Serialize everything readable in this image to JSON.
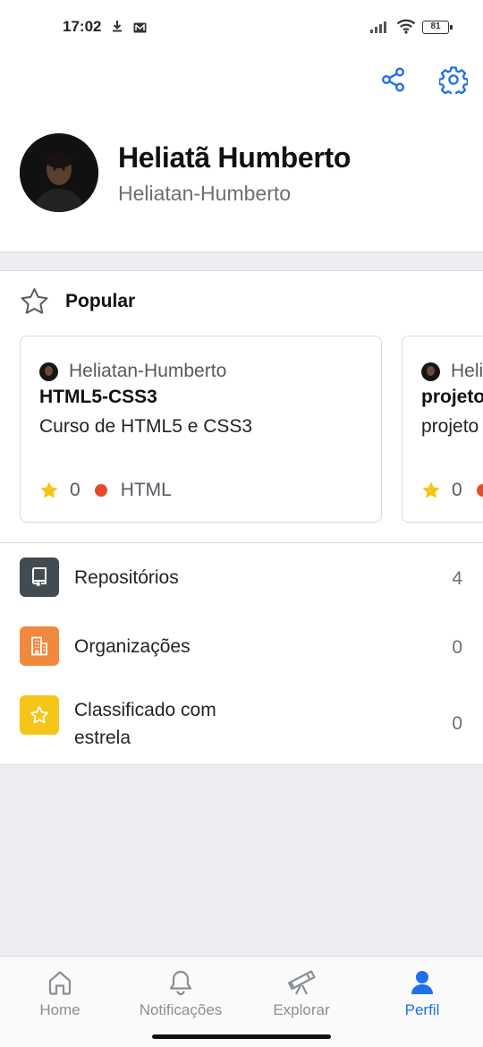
{
  "status_bar": {
    "time": "17:02",
    "battery": "81"
  },
  "header": {
    "share_icon": "share-icon",
    "settings_icon": "gear-icon"
  },
  "profile": {
    "name": "Heliatã Humberto",
    "login": "Heliatan-Humberto"
  },
  "popular": {
    "title": "Popular",
    "cards": [
      {
        "owner": "Heliatan-Humberto",
        "repo": "HTML5-CSS3",
        "description": "Curso de HTML5 e CSS3",
        "stars": "0",
        "language": "HTML",
        "language_color": "#e34c26"
      },
      {
        "owner": "Heliatan-Humberto",
        "repo": "projeto",
        "description": "projeto",
        "stars": "0",
        "language": "",
        "language_color": "#e34c26"
      }
    ]
  },
  "menu": {
    "items": [
      {
        "label": "Repositórios",
        "count": "4",
        "color": "#424a53",
        "icon": "repo-icon"
      },
      {
        "label": "Organizações",
        "count": "0",
        "color": "#f0883e",
        "icon": "organization-icon"
      },
      {
        "label": "Classificado com estrela",
        "count": "0",
        "color": "#f5c518",
        "icon": "star-icon"
      }
    ]
  },
  "bottom_nav": {
    "items": [
      {
        "label": "Home",
        "icon": "home-icon"
      },
      {
        "label": "Notificações",
        "icon": "bell-icon"
      },
      {
        "label": "Explorar",
        "icon": "telescope-icon"
      },
      {
        "label": "Perfil",
        "icon": "person-icon"
      }
    ],
    "active": "Perfil",
    "active_color": "#1f6feb"
  }
}
